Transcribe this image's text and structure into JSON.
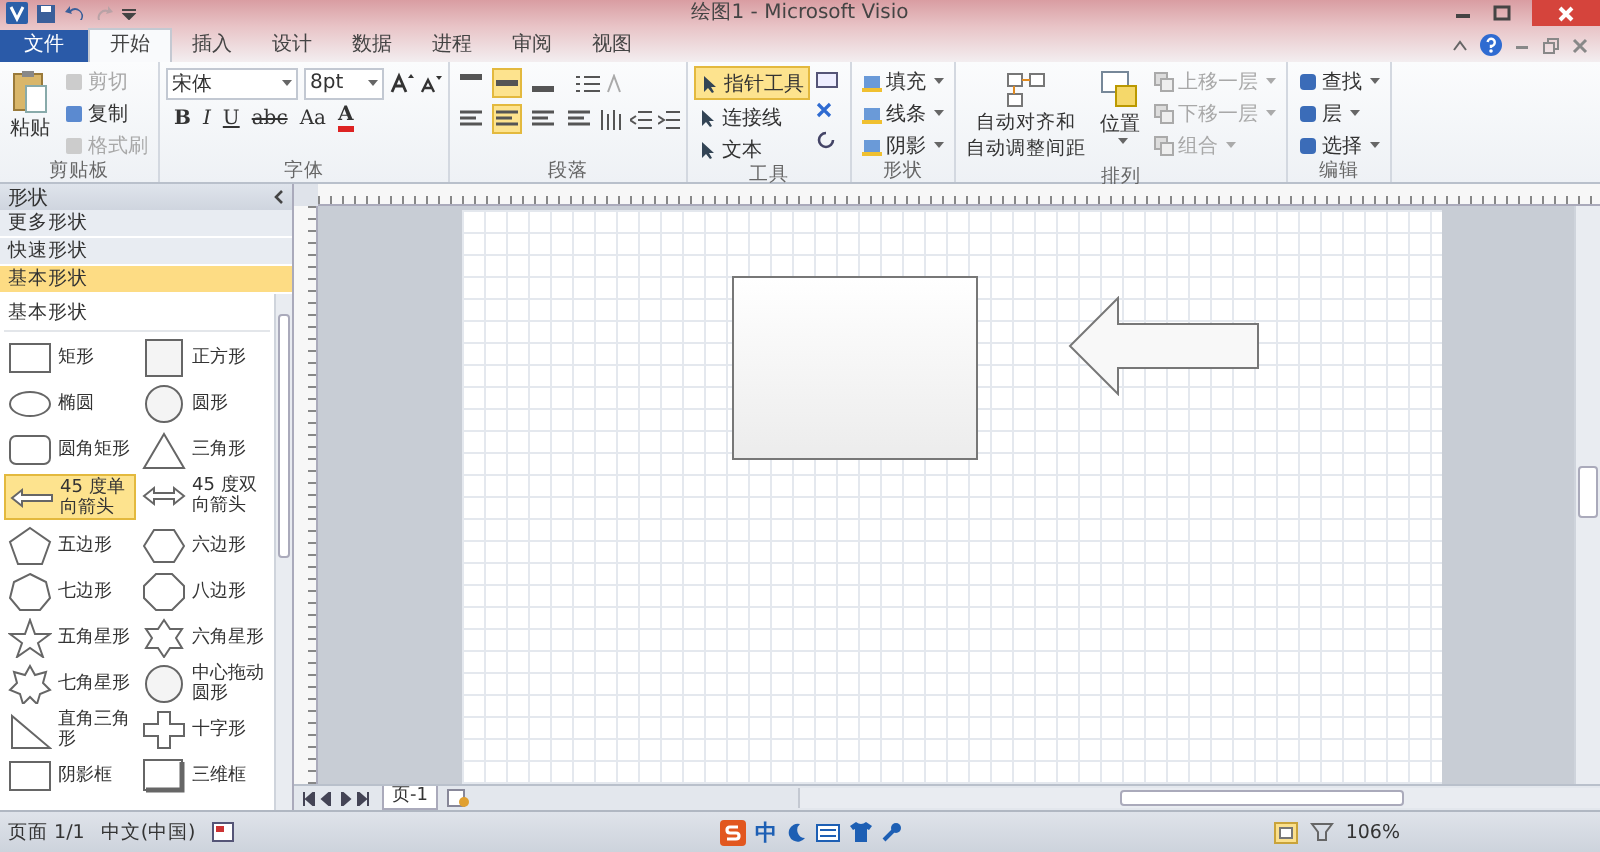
{
  "window": {
    "title": "绘图1 - Microsoft Visio"
  },
  "tabs": [
    {
      "label": "文件",
      "kind": "file",
      "selected": false
    },
    {
      "label": "开始",
      "kind": "tab",
      "selected": true
    },
    {
      "label": "插入",
      "kind": "tab",
      "selected": false
    },
    {
      "label": "设计",
      "kind": "tab",
      "selected": false
    },
    {
      "label": "数据",
      "kind": "tab",
      "selected": false
    },
    {
      "label": "进程",
      "kind": "tab",
      "selected": false
    },
    {
      "label": "审阅",
      "kind": "tab",
      "selected": false
    },
    {
      "label": "视图",
      "kind": "tab",
      "selected": false
    }
  ],
  "ribbon": [
    {
      "kind": "clipboard",
      "label": "剪贴板",
      "big": "粘贴",
      "items": [
        {
          "label": "剪切",
          "disabled": true
        },
        {
          "label": "复制",
          "disabled": false
        },
        {
          "label": "格式刷",
          "disabled": true
        }
      ]
    },
    {
      "kind": "font",
      "label": "字体",
      "font": "宋体",
      "size": "8pt",
      "styles": [
        "B",
        "I",
        "U",
        "abc",
        "Aa",
        "A"
      ]
    },
    {
      "kind": "paragraph",
      "label": "段落",
      "vertical": [
        {
          "selected": false
        },
        {
          "selected": true
        },
        {
          "selected": false
        }
      ],
      "horizontal": [
        {
          "selected": false
        },
        {
          "selected": true
        },
        {
          "selected": false
        },
        {
          "selected": false
        }
      ]
    },
    {
      "kind": "tools",
      "label": "工具",
      "items": [
        {
          "label": "指针工具",
          "selected": true
        },
        {
          "label": "连接线",
          "selected": false
        },
        {
          "label": "文本",
          "selected": false
        }
      ]
    },
    {
      "kind": "shapes",
      "label": "形状",
      "items": [
        {
          "label": "填充"
        },
        {
          "label": "线条"
        },
        {
          "label": "阴影"
        }
      ]
    },
    {
      "kind": "arrange",
      "label": "排列",
      "big": [
        "自动对齐和",
        "自动调整间距"
      ],
      "position": "位置",
      "items": [
        {
          "label": "上移一层",
          "disabled": true
        },
        {
          "label": "下移一层",
          "disabled": true
        },
        {
          "label": "组合",
          "disabled": true
        }
      ]
    },
    {
      "kind": "edit",
      "label": "编辑",
      "items": [
        {
          "label": "查找"
        },
        {
          "label": "层"
        },
        {
          "label": "选择"
        }
      ]
    }
  ],
  "shapes_panel": {
    "title": "形状",
    "sections": [
      {
        "label": "更多形状",
        "selected": false
      },
      {
        "label": "快速形状",
        "selected": false
      },
      {
        "label": "基本形状",
        "selected": true
      }
    ],
    "stencil_title": "基本形状",
    "items": [
      {
        "label": "矩形",
        "kind": "rect",
        "selected": false
      },
      {
        "label": "正方形",
        "kind": "square",
        "selected": false
      },
      {
        "label": "椭圆",
        "kind": "ellipse",
        "selected": false
      },
      {
        "label": "圆形",
        "kind": "circle",
        "selected": false
      },
      {
        "label": "圆角矩形",
        "kind": "roundrect",
        "selected": false
      },
      {
        "label": "三角形",
        "kind": "triangle",
        "selected": false
      },
      {
        "label": "45 度单向箭头",
        "kind": "arrow1",
        "selected": true
      },
      {
        "label": "45 度双向箭头",
        "kind": "arrow2",
        "selected": false
      },
      {
        "label": "五边形",
        "kind": "pentagon",
        "selected": false
      },
      {
        "label": "六边形",
        "kind": "hexagon",
        "selected": false
      },
      {
        "label": "七边形",
        "kind": "heptagon",
        "selected": false
      },
      {
        "label": "八边形",
        "kind": "octagon",
        "selected": false
      },
      {
        "label": "五角星形",
        "kind": "star5",
        "selected": false
      },
      {
        "label": "六角星形",
        "kind": "star6",
        "selected": false
      },
      {
        "label": "七角星形",
        "kind": "star7",
        "selected": false
      },
      {
        "label": "中心拖动圆形",
        "kind": "circle",
        "selected": false
      },
      {
        "label": "直角三角形",
        "kind": "righttri",
        "selected": false
      },
      {
        "label": "十字形",
        "kind": "cross",
        "selected": false
      },
      {
        "label": "阴影框",
        "kind": "rect",
        "selected": false
      },
      {
        "label": "三维框",
        "kind": "box3d",
        "selected": false
      }
    ]
  },
  "page_tab": "页-1",
  "status_bar": {
    "page": "页面 1/1",
    "language": "中文(中国)",
    "ime": "中",
    "zoom": "106%"
  }
}
